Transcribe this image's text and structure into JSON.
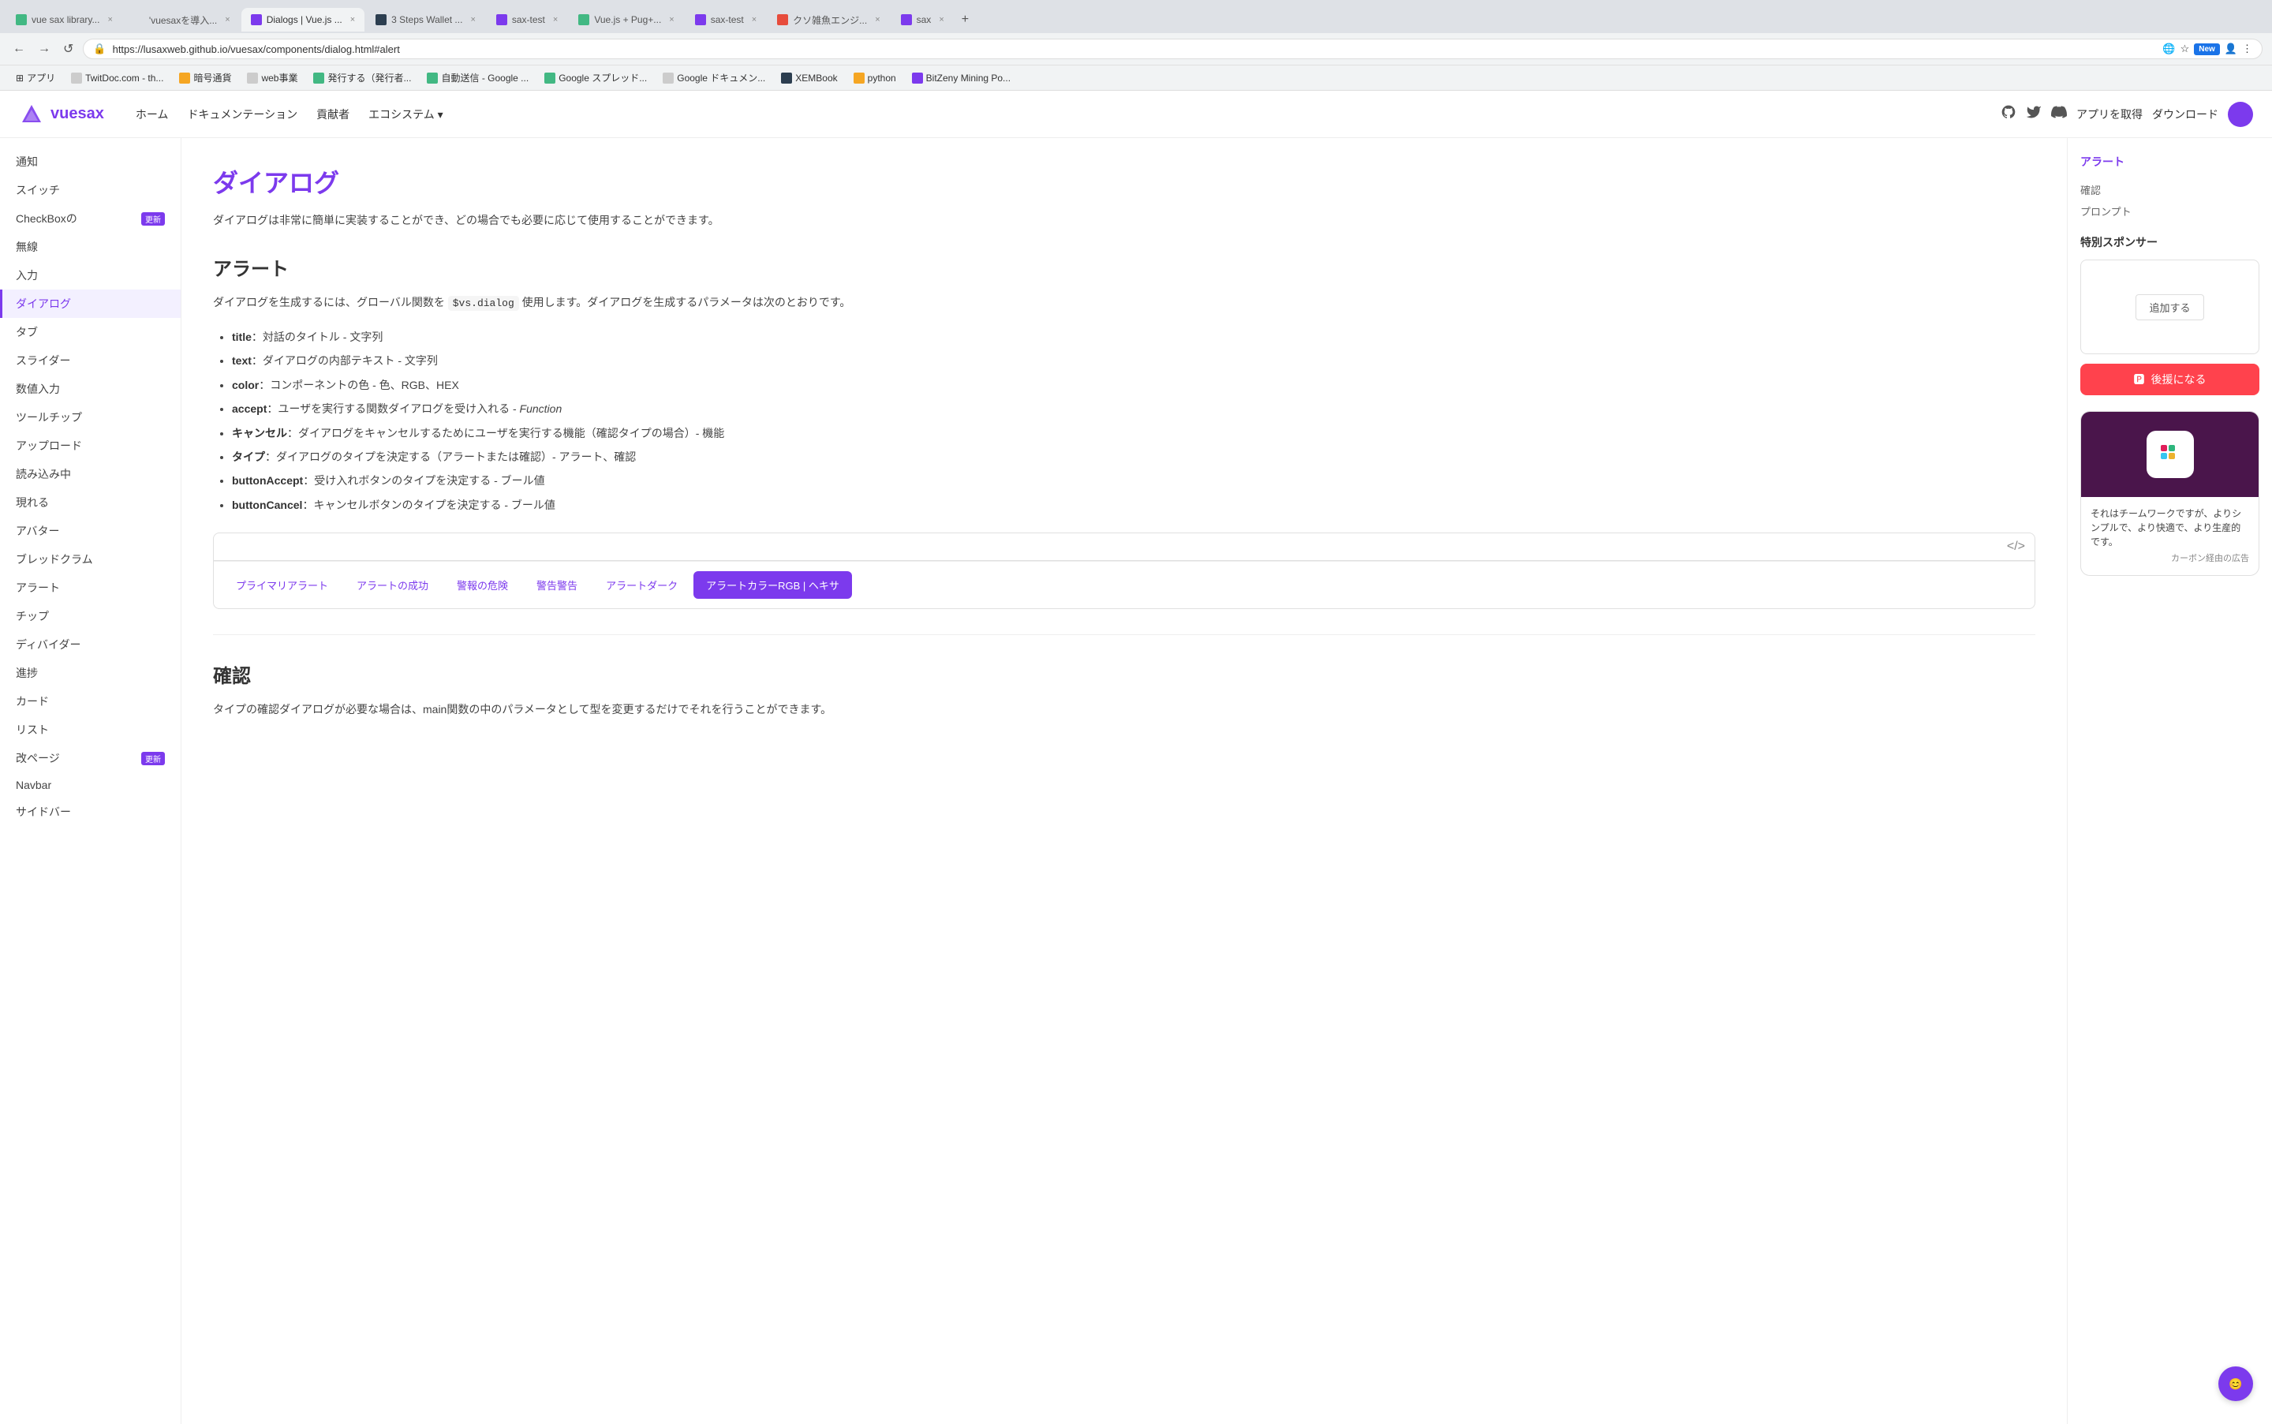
{
  "browser": {
    "url": "https://lusaxweb.github.io/vuesax/components/dialog.html#alert",
    "tabs": [
      {
        "id": "t1",
        "label": "vue sax library...",
        "favicon_color": "#42b883",
        "active": false
      },
      {
        "id": "t2",
        "label": "'vuesaxを導入...",
        "favicon_color": "#4285f4",
        "active": false
      },
      {
        "id": "t3",
        "label": "Dialogs | Vue.js ...",
        "favicon_color": "#7c3aed",
        "active": true
      },
      {
        "id": "t4",
        "label": "3 Steps Wallet ...",
        "favicon_color": "#2c3e50",
        "active": false
      },
      {
        "id": "t5",
        "label": "sax-test",
        "favicon_color": "#7c3aed",
        "active": false
      },
      {
        "id": "t6",
        "label": "Vue.js + Pug+...",
        "favicon_color": "#42b883",
        "active": false
      },
      {
        "id": "t7",
        "label": "sax-test",
        "favicon_color": "#7c3aed",
        "active": false
      },
      {
        "id": "t8",
        "label": "クソ雑魚エンジ...",
        "favicon_color": "#e74c3c",
        "active": false
      },
      {
        "id": "t9",
        "label": "sax",
        "favicon_color": "#7c3aed",
        "active": false
      }
    ],
    "bookmarks": [
      {
        "label": "TwitDoc.com - th...",
        "color": "#4285f4"
      },
      {
        "label": "暗号通貨",
        "color": "#f5a623"
      },
      {
        "label": "web事業",
        "color": "#4285f4"
      },
      {
        "label": "発行する（発行者...",
        "color": "#42b883"
      },
      {
        "label": "自動送信 - Google ...",
        "color": "#42b883"
      },
      {
        "label": "Google スプレッド...",
        "color": "#42b883"
      },
      {
        "label": "Google ドキュメン...",
        "color": "#4285f4"
      },
      {
        "label": "XEMBook",
        "color": "#333"
      },
      {
        "label": "python",
        "color": "#f5a623"
      },
      {
        "label": "BitZeny Mining Po...",
        "color": "#7c3aed"
      }
    ],
    "new_badge": "New"
  },
  "header": {
    "logo": "vuesax",
    "nav_items": [
      "ホーム",
      "ドキュメンテーション",
      "貢献者",
      "エコシステム keyboard_arrow_down"
    ],
    "nav": {
      "home": "ホーム",
      "docs": "ドキュメンテーション",
      "contrib": "貢献者",
      "ecosystem": "エコシステム",
      "ecosystem_arrow": "keyboard_arrow_down"
    },
    "actions": {
      "get_app": "アプリを取得",
      "download": "ダウンロード"
    }
  },
  "sidebar": {
    "items": [
      {
        "label": "通知",
        "active": false
      },
      {
        "label": "スイッチ",
        "active": false
      },
      {
        "label": "CheckBoxの",
        "active": false,
        "badge": "更新"
      },
      {
        "label": "無線",
        "active": false
      },
      {
        "label": "入力",
        "active": false
      },
      {
        "label": "ダイアログ",
        "active": true
      },
      {
        "label": "タブ",
        "active": false
      },
      {
        "label": "スライダー",
        "active": false
      },
      {
        "label": "数値入力",
        "active": false
      },
      {
        "label": "ツールチップ",
        "active": false
      },
      {
        "label": "アップロード",
        "active": false
      },
      {
        "label": "読み込み中",
        "active": false
      },
      {
        "label": "現れる",
        "active": false
      },
      {
        "label": "アバター",
        "active": false
      },
      {
        "label": "ブレッドクラム",
        "active": false
      },
      {
        "label": "アラート",
        "active": false
      },
      {
        "label": "チップ",
        "active": false
      },
      {
        "label": "ディバイダー",
        "active": false
      },
      {
        "label": "進捗",
        "active": false
      },
      {
        "label": "カード",
        "active": false
      },
      {
        "label": "リスト",
        "active": false
      },
      {
        "label": "改ページ",
        "active": false,
        "badge": "更新"
      },
      {
        "label": "Navbar",
        "active": false
      },
      {
        "label": "サイドバー",
        "active": false
      }
    ]
  },
  "main": {
    "page_title": "ダイアログ",
    "page_desc": "ダイアログは非常に簡単に実装することができ、どの場合でも必要に応じて使用することができます。",
    "alert_section": {
      "title": "アラート",
      "desc1": "ダイアログを生成するには、グローバル関数を",
      "code": "$vs.dialog",
      "desc2": "使用します。ダイアログを生成するパラメータは次のとおりです。",
      "params": [
        {
          "key": "title",
          "desc": "：対話のタイトル - 文字列"
        },
        {
          "key": "text",
          "desc": "：ダイアログの内部テキスト - 文字列"
        },
        {
          "key": "color",
          "desc": "：コンポーネントの色 - 色、RGB、HEX"
        },
        {
          "key": "accept",
          "desc": "：ユーザを実行する関数ダイアログを受け入れる - Function"
        },
        {
          "key": "キャンセル",
          "desc": "：ダイアログをキャンセルするためにユーザを実行する機能（確認タイプの場合）- 機能",
          "bold": true
        },
        {
          "key": "タイプ",
          "desc": "：ダイアログのタイプを決定する（アラートまたは確認）- アラート、確認",
          "bold": true
        },
        {
          "key": "buttonAccept",
          "desc": "：受け入れボタンのタイプを決定する - ブール値"
        },
        {
          "key": "buttonCancel",
          "desc": "：キャンセルボタンのタイプを決定する - ブール値"
        }
      ],
      "demo_tabs": [
        {
          "label": "プライマリアラート",
          "active": false
        },
        {
          "label": "アラートの成功",
          "active": false
        },
        {
          "label": "警報の危険",
          "active": false
        },
        {
          "label": "警告警告",
          "active": false
        },
        {
          "label": "アラートダーク",
          "active": false
        },
        {
          "label": "アラートカラーRGB | ヘキサ",
          "active": true
        }
      ]
    },
    "confirm_section": {
      "title": "確認",
      "desc": "タイプの確認ダイアログが必要な場合は、main関数の中のパラメータとして型を変更するだけでそれを行うことができます。"
    }
  },
  "toc": {
    "title": "アラート",
    "items": [
      {
        "label": "確認"
      },
      {
        "label": "プロンプト"
      }
    ]
  },
  "sponsor": {
    "section_title": "特別スポンサー",
    "add_btn": "追加する",
    "patreon_btn": "後援になる",
    "slack_text": "それはチームワークですが、よりシンプルで、より快適で、より生産的です。",
    "carbon_link": "カーボン経由の広告"
  },
  "chat_bubble_icon": "😊"
}
